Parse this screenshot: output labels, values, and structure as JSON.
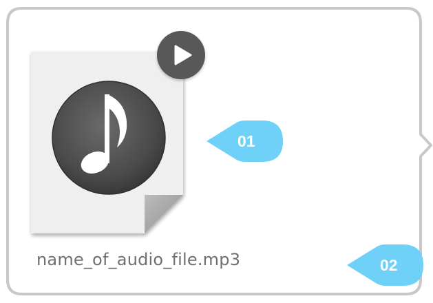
{
  "file": {
    "name": "name_of_audio_file.mp3",
    "type_icon": "music-note-icon",
    "play_icon": "play-icon"
  },
  "callouts": {
    "first": "01",
    "second": "02"
  },
  "colors": {
    "frame_border": "#c8c8c8",
    "page_fill": "#efefef",
    "music_disc": "#4a4a4a",
    "play_button": "#585858",
    "callout": "#6fd0f8",
    "filename_text": "#6f6f6f"
  }
}
